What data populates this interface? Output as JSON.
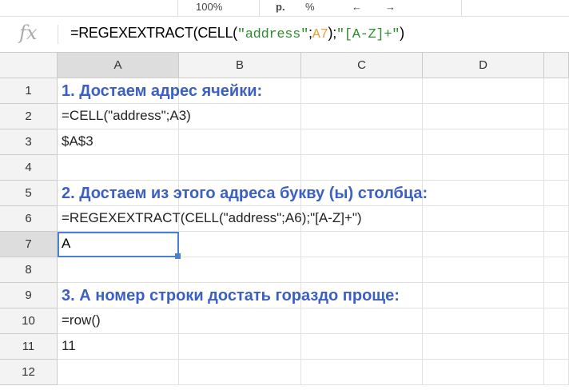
{
  "toolbar": {
    "zoom": "100%",
    "currency": "р.",
    "percent": "%",
    "dec_dec": "←",
    "inc_dec": "→"
  },
  "formula_bar": {
    "icon": "fx",
    "parts": [
      "=REGEXEXTRACT(CELL(",
      "\"address\"",
      ";",
      "A7",
      ");",
      "\"[A-Z]+\"",
      ")"
    ]
  },
  "columns": [
    "A",
    "B",
    "C",
    "D"
  ],
  "rows": [
    "1",
    "2",
    "3",
    "4",
    "5",
    "6",
    "7",
    "8",
    "9",
    "10",
    "11",
    "12"
  ],
  "cells": {
    "A1": "1. Достаем адрес ячейки:",
    "A2": "=CELL(\"address\";A3)",
    "A3": "$A$3",
    "A5": "2. Достаем из этого адреса букву (ы) столбца:",
    "A6": "=REGEXEXTRACT(CELL(\"address\";A6);\"[A-Z]+\")",
    "A7": "A",
    "A9": "3. А номер строки достать гораздо проще:",
    "A10": "=row()",
    "A11": "11"
  },
  "colors": {
    "title": "#3c5fc4",
    "selection": "#4a7fd6"
  }
}
